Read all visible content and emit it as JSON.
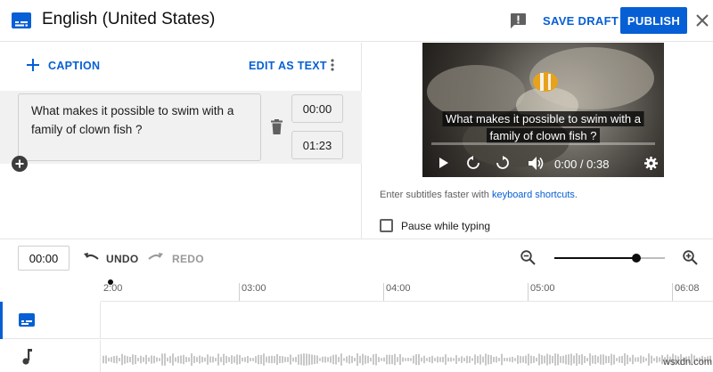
{
  "header": {
    "title": "English (United States)",
    "save_draft": "SAVE DRAFT",
    "publish": "PUBLISH"
  },
  "editor": {
    "add_caption": "CAPTION",
    "edit_as_text": "EDIT AS TEXT",
    "caption_text": "What makes it possible to swim with a family of clown fish ?",
    "start_time": "00:00",
    "end_time": "01:23"
  },
  "video": {
    "subtitle_line1": "What makes it possible to swim with a",
    "subtitle_line2": "family of clown fish ?",
    "time": "0:00 / 0:38"
  },
  "hint": {
    "prefix": "Enter subtitles faster with ",
    "link": "keyboard shortcuts",
    "suffix": "."
  },
  "pause_while_typing": "Pause while typing",
  "timeline": {
    "current_time": "00:00",
    "undo": "UNDO",
    "redo": "REDO",
    "ticks": [
      "2:00",
      "03:00",
      "04:00",
      "05:00",
      "06:08"
    ]
  },
  "watermark": "wsxdn.com"
}
